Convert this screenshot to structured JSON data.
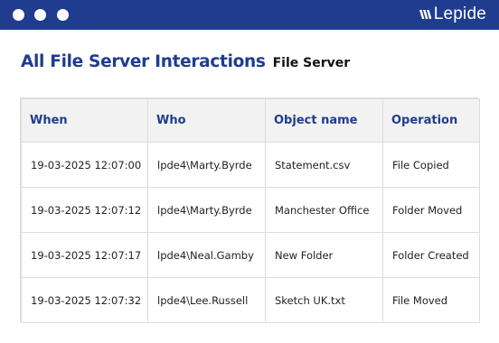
{
  "window": {
    "brand": "Lepide",
    "colors": {
      "titlebar": "#1f3c8f",
      "accent": "#1f3c8f",
      "header_bg": "#f2f2f2"
    }
  },
  "page": {
    "title": "All File Server Interactions",
    "subtitle": "File Server"
  },
  "table": {
    "columns": [
      "When",
      "Who",
      "Object name",
      "Operation"
    ],
    "rows": [
      [
        "19-03-2025 12:07:00",
        "lpde4\\Marty.Byrde",
        "Statement.csv",
        "File Copied"
      ],
      [
        "19-03-2025 12:07:12",
        "lpde4\\Marty.Byrde",
        "Manchester Office",
        "Folder Moved"
      ],
      [
        "19-03-2025 12:07:17",
        "lpde4\\Neal.Gamby",
        "New Folder",
        "Folder Created"
      ],
      [
        "19-03-2025 12:07:32",
        "lpde4\\Lee.Russell",
        "Sketch UK.txt",
        "File Moved"
      ]
    ]
  }
}
